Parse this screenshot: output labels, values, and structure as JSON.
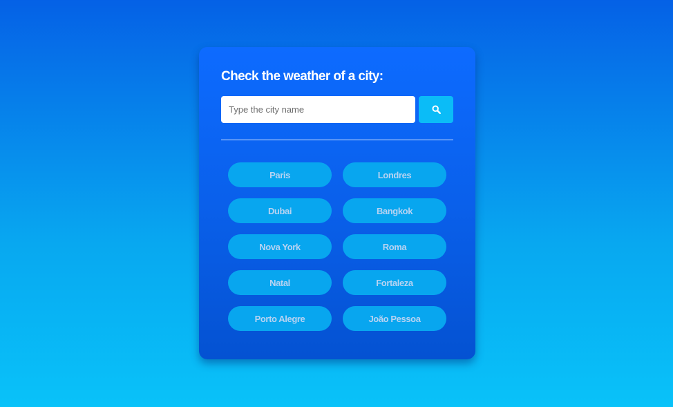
{
  "weather": {
    "title": "Check the weather of a city:",
    "search": {
      "placeholder": "Type the city name",
      "value": "",
      "button_icon": "search-icon"
    },
    "cities": [
      {
        "label": "Paris"
      },
      {
        "label": "Londres"
      },
      {
        "label": "Dubai"
      },
      {
        "label": "Bangkok"
      },
      {
        "label": "Nova York"
      },
      {
        "label": "Roma"
      },
      {
        "label": "Natal"
      },
      {
        "label": "Fortaleza"
      },
      {
        "label": "Porto Alegre"
      },
      {
        "label": "João Pessoa"
      }
    ]
  },
  "colors": {
    "background_top": "#0561e6",
    "background_bottom": "#09c2f9",
    "card": "#0a60eb",
    "search_button": "#0bbcf7",
    "city_button": "#08a6ef",
    "city_text": "#b7d3f2"
  }
}
